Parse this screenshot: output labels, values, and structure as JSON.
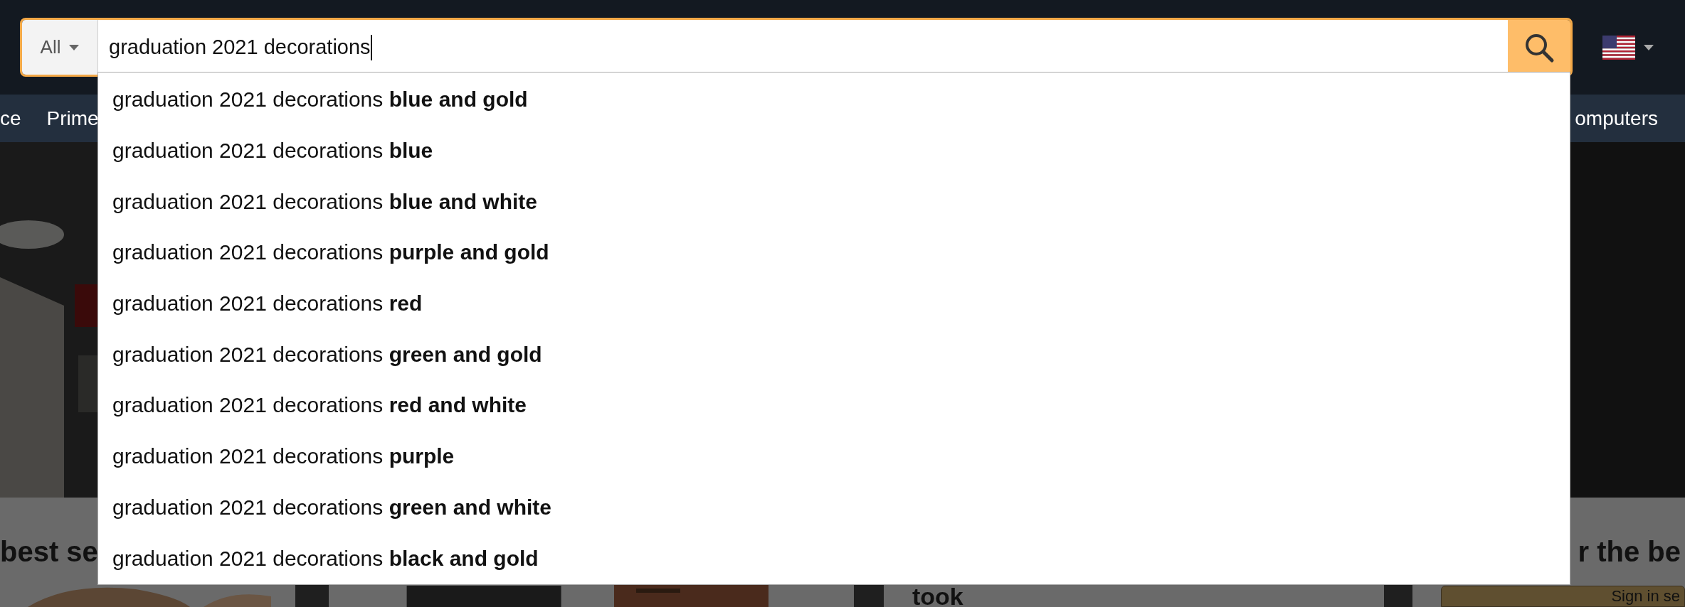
{
  "search": {
    "category": "All",
    "value": "graduation 2021 decorations"
  },
  "nav": {
    "left": [
      "ce",
      "Prime"
    ],
    "right": "omputers"
  },
  "suggestions": [
    "graduation 2021 decorations **blue and gold**",
    "graduation 2021 decorations **blue**",
    "graduation 2021 decorations **blue and white**",
    "graduation 2021 decorations **purple and gold**",
    "graduation 2021 decorations **red**",
    "graduation 2021 decorations **green and gold**",
    "graduation 2021 decorations **red and white**",
    "graduation 2021 decorations **purple**",
    "graduation 2021 decorations **green and white**",
    "graduation 2021 decorations **black and gold**"
  ],
  "cards": [
    {
      "heading": "best se"
    },
    {
      "heading": "took"
    },
    {
      "heading": "r the be",
      "button": "Sign in se"
    }
  ]
}
